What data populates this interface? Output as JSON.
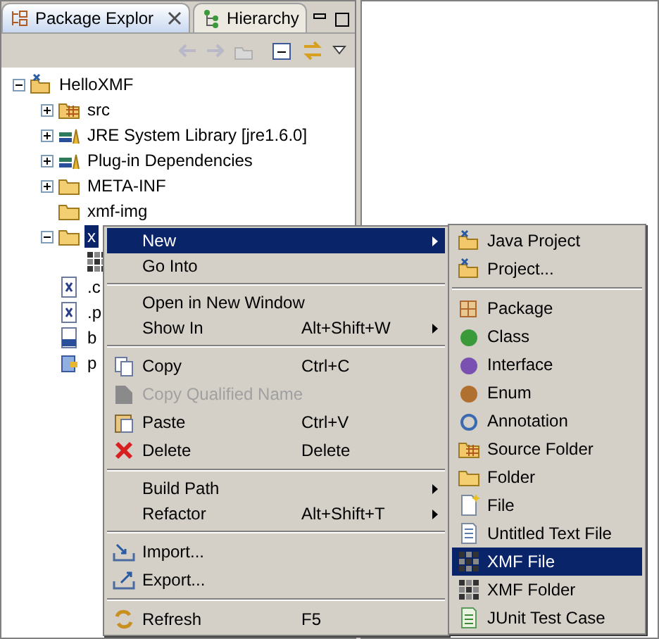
{
  "tabs": [
    {
      "label": "Package Explor",
      "selected": true
    },
    {
      "label": "Hierarchy",
      "selected": false
    }
  ],
  "tree": [
    {
      "label": "HelloXMF",
      "kind": "project",
      "expanded": true,
      "selected": false,
      "children": [
        {
          "label": "src",
          "kind": "source-folder",
          "expanded": false,
          "selected": false
        },
        {
          "label": "JRE System Library [jre1.6.0]",
          "kind": "library",
          "expanded": false,
          "selected": false
        },
        {
          "label": "Plug-in Dependencies",
          "kind": "library",
          "expanded": false,
          "selected": false
        },
        {
          "label": "META-INF",
          "kind": "folder",
          "expanded": false,
          "selected": false
        },
        {
          "label": "xmf-img",
          "kind": "folder",
          "selected": false
        },
        {
          "label": "x",
          "kind": "folder",
          "expanded": true,
          "selected": true,
          "children": [
            {
              "kind": "grid"
            }
          ]
        },
        {
          "label": ".c",
          "kind": "x-file",
          "selected": false
        },
        {
          "label": ".p",
          "kind": "x-file",
          "selected": false
        },
        {
          "label": "b",
          "kind": "binary",
          "selected": false
        },
        {
          "label": "p",
          "kind": "plugin",
          "selected": false
        }
      ]
    }
  ],
  "context_menu": [
    {
      "kind": "item",
      "label": "New",
      "submenu": true,
      "selected": true,
      "disabled": false
    },
    {
      "kind": "item",
      "label": "Go Into",
      "submenu": false,
      "selected": false,
      "disabled": false
    },
    {
      "kind": "separator"
    },
    {
      "kind": "item",
      "label": "Open in New Window",
      "submenu": false,
      "selected": false,
      "disabled": false
    },
    {
      "kind": "item",
      "label": "Show In",
      "shortcut": "Alt+Shift+W",
      "submenu": true,
      "selected": false,
      "disabled": false
    },
    {
      "kind": "separator"
    },
    {
      "kind": "item",
      "label": "Copy",
      "shortcut": "Ctrl+C",
      "submenu": false,
      "selected": false,
      "disabled": false
    },
    {
      "kind": "item",
      "label": "Copy Qualified Name",
      "submenu": false,
      "selected": false,
      "disabled": true
    },
    {
      "kind": "item",
      "label": "Paste",
      "shortcut": "Ctrl+V",
      "submenu": false,
      "selected": false,
      "disabled": false
    },
    {
      "kind": "item",
      "label": "Delete",
      "shortcut": "Delete",
      "submenu": false,
      "selected": false,
      "disabled": false
    },
    {
      "kind": "separator"
    },
    {
      "kind": "item",
      "label": "Build Path",
      "submenu": true,
      "selected": false,
      "disabled": false
    },
    {
      "kind": "item",
      "label": "Refactor",
      "shortcut": "Alt+Shift+T",
      "submenu": true,
      "selected": false,
      "disabled": false
    },
    {
      "kind": "separator"
    },
    {
      "kind": "item",
      "label": "Import...",
      "submenu": false,
      "selected": false,
      "disabled": false
    },
    {
      "kind": "item",
      "label": "Export...",
      "submenu": false,
      "selected": false,
      "disabled": false
    },
    {
      "kind": "separator"
    },
    {
      "kind": "item",
      "label": "Refresh",
      "shortcut": "F5",
      "submenu": false,
      "selected": false,
      "disabled": false
    }
  ],
  "submenu": [
    {
      "kind": "item",
      "label": "Java Project",
      "selected": false
    },
    {
      "kind": "item",
      "label": "Project...",
      "selected": false
    },
    {
      "kind": "separator"
    },
    {
      "kind": "item",
      "label": "Package",
      "selected": false
    },
    {
      "kind": "item",
      "label": "Class",
      "selected": false
    },
    {
      "kind": "item",
      "label": "Interface",
      "selected": false
    },
    {
      "kind": "item",
      "label": "Enum",
      "selected": false
    },
    {
      "kind": "item",
      "label": "Annotation",
      "selected": false
    },
    {
      "kind": "item",
      "label": "Source Folder",
      "selected": false
    },
    {
      "kind": "item",
      "label": "Folder",
      "selected": false
    },
    {
      "kind": "item",
      "label": "File",
      "selected": false
    },
    {
      "kind": "item",
      "label": "Untitled Text File",
      "selected": false
    },
    {
      "kind": "item",
      "label": "XMF File",
      "selected": true
    },
    {
      "kind": "item",
      "label": "XMF Folder",
      "selected": false
    },
    {
      "kind": "item",
      "label": "JUnit Test Case",
      "selected": false
    }
  ]
}
